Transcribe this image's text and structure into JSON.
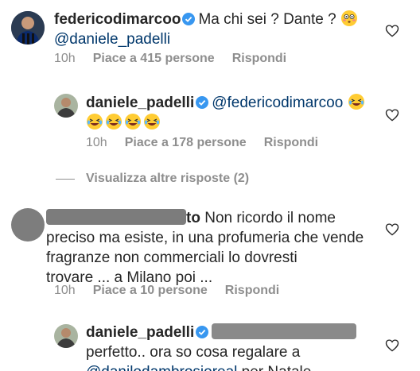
{
  "comments": [
    {
      "username": "federicodimarcoo",
      "text": "Ma chi sei ? Dante ?",
      "mention": "@daniele_padelli",
      "time": "10h",
      "likes": "Piace a 415 persone",
      "reply": "Rispondi"
    },
    {
      "username": "daniele_padelli",
      "mention": "@federicodimarcoo",
      "time": "10h",
      "likes": "Piace a 178 persone",
      "reply": "Rispondi"
    },
    {
      "username_suffix": "to",
      "line1": "Non ricordo il nome",
      "line2": "preciso ma esiste, in una profumeria che vende",
      "line3": "fragranze non commerciali lo dovresti",
      "line4": "trovare ... a Milano poi ...",
      "time": "10h",
      "likes": "Piace a 10 persone",
      "reply": "Rispondi"
    },
    {
      "username": "daniele_padelli",
      "line1": "perfetto.. ora so cosa regalare a",
      "mention": "@danilodambrosioreal",
      "line2_rest": "per Natale.."
    }
  ],
  "view_more": "Visualizza altre risposte (2)",
  "colors": {
    "text": "#262626",
    "meta": "#8e8e8e",
    "mention": "#00376b",
    "verified": "#3897f0"
  }
}
